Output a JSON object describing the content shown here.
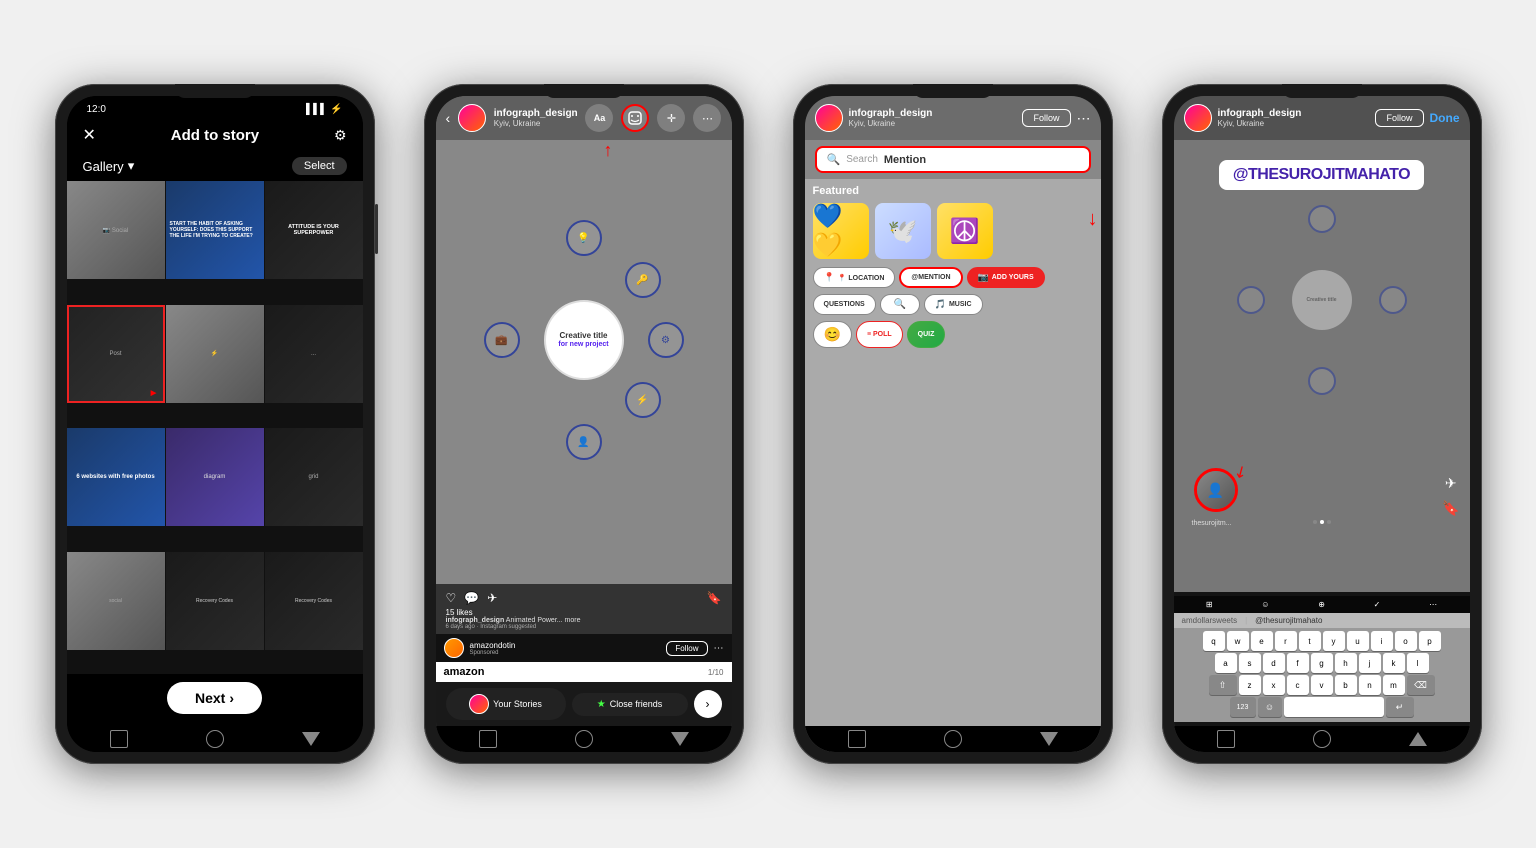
{
  "scene": {
    "bg": "#f0f0f0"
  },
  "phone1": {
    "status_time": "12:0",
    "header_title": "Add to story",
    "gallery_label": "Gallery",
    "select_label": "Select",
    "next_label": "Next",
    "thumbs": [
      {
        "id": "t1",
        "style": "grey",
        "text": ""
      },
      {
        "id": "t2",
        "style": "blue",
        "text": "START THE HABIT OF ASKING YOURSELF: DOES THIS SUPPORT THE LIFE I'M TRYING TO CREATE?"
      },
      {
        "id": "t3",
        "style": "dark",
        "text": "ATTITUDE IS YOUR SUPERPOWER"
      },
      {
        "id": "t4",
        "style": "selected",
        "text": ""
      },
      {
        "id": "t5",
        "style": "grey",
        "text": ""
      },
      {
        "id": "t6",
        "style": "dark",
        "text": ""
      },
      {
        "id": "t7",
        "style": "blue-websites",
        "text": "6 websites with free photos"
      },
      {
        "id": "t8",
        "style": "purple",
        "text": ""
      },
      {
        "id": "t9",
        "style": "dark",
        "text": ""
      },
      {
        "id": "t10",
        "style": "grey",
        "text": ""
      },
      {
        "id": "t11",
        "style": "dark",
        "text": "Recovery Codes"
      },
      {
        "id": "t12",
        "style": "dark",
        "text": "Recovery Codes"
      }
    ]
  },
  "phone2": {
    "username": "infograph_design",
    "location": "Kyiv, Ukraine",
    "diagram_title": "Creative title",
    "diagram_subtitle": "for new project",
    "your_stories_label": "Your Stories",
    "close_friends_label": "Close friends",
    "next_label": "›",
    "likes_count": "15 likes",
    "post_author": "infograph_design",
    "post_caption": "Animated Power... more",
    "post_time": "6 days ago · Instagram suggested",
    "next_ad": "amazondotin",
    "follow_label": "Follow",
    "ad_label": "amazon",
    "page_indicator": "1/10",
    "toolbar_items": [
      "Aa",
      "sticker",
      "move",
      "more"
    ]
  },
  "phone3": {
    "username": "infograph_design",
    "location": "Kyiv, Ukraine",
    "follow_label": "Follow",
    "search_placeholder": "Search",
    "mention_text": "Mention",
    "featured_label": "Featured",
    "stickers": [
      "💙💛",
      "🕊️",
      "☮️"
    ],
    "tag_location": "📍 LOCATION",
    "tag_mention": "@MENTION",
    "tag_addyours": "📷 ADD YOURS",
    "tag_questions": "QUESTIONS",
    "tag_search": "🔍",
    "tag_music": "🎵 MUSIC",
    "tag_emoji": "😊",
    "tag_poll": "≡ POLL",
    "tag_quiz": "QUIZ"
  },
  "phone4": {
    "username": "infograph_design",
    "location": "Kyiv, Ukraine",
    "follow_label": "Follow",
    "done_label": "Done",
    "mention_handle": "@THESUROJITMAHATO",
    "bottom_username": "thesurojitm...",
    "autocomplete_items": [
      "amdollarsweets",
      "@thesurojitmahato"
    ],
    "keyboard_rows": [
      [
        "q",
        "w",
        "e",
        "r",
        "t",
        "y",
        "u",
        "i",
        "o",
        "p"
      ],
      [
        "a",
        "s",
        "d",
        "f",
        "g",
        "h",
        "j",
        "k",
        "l"
      ],
      [
        "z",
        "x",
        "c",
        "v",
        "b",
        "n",
        "m"
      ]
    ],
    "num_label": "123",
    "emoji_label": "☺",
    "return_label": "↵",
    "shift_label": "⇧",
    "backspace_label": "⌫"
  }
}
